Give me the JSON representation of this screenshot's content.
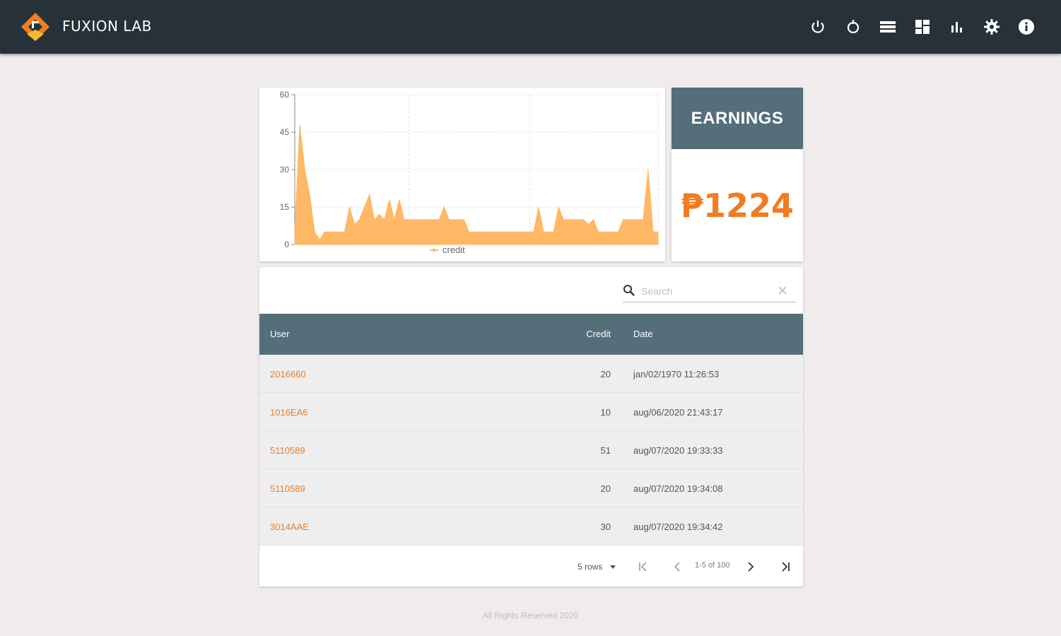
{
  "app": {
    "brand": "FUXION LAB",
    "nav_icons": [
      "power-icon",
      "timer-icon",
      "list-icon",
      "dashboard-icon",
      "bar-chart-icon",
      "settings-icon",
      "info-icon"
    ]
  },
  "colors": {
    "appbar": "#263238",
    "accent": "#f07c23",
    "header_slate": "#546e7a",
    "chart_fill": "#ffb866"
  },
  "earnings": {
    "title": "EARNINGS",
    "value": "₱1224"
  },
  "chart_data": {
    "type": "area",
    "title": "",
    "xlabel": "",
    "ylabel": "",
    "ylim": [
      0,
      60
    ],
    "yticks": [
      "0",
      "15",
      "30",
      "45",
      "60"
    ],
    "grid": true,
    "legend_position": "bottom",
    "series": [
      {
        "name": "credit",
        "values": [
          5,
          48,
          30,
          20,
          5,
          2,
          5,
          5,
          5,
          5,
          5,
          15,
          8,
          10,
          15,
          20,
          10,
          12,
          10,
          18,
          10,
          18,
          10,
          10,
          10,
          10,
          10,
          10,
          10,
          10,
          15,
          10,
          10,
          10,
          10,
          5,
          5,
          5,
          5,
          5,
          5,
          5,
          5,
          5,
          5,
          5,
          5,
          5,
          5,
          15,
          5,
          5,
          5,
          15,
          10,
          10,
          10,
          10,
          10,
          8,
          10,
          5,
          5,
          5,
          5,
          5,
          10,
          10,
          10,
          10,
          10,
          30,
          5,
          5
        ]
      }
    ]
  },
  "table": {
    "search_placeholder": "Search",
    "columns": {
      "user": "User",
      "credit": "Credit",
      "date": "Date"
    },
    "rows": [
      {
        "user": "2016660",
        "credit": "20",
        "date": "jan/02/1970 11:26:53"
      },
      {
        "user": "1016EA6",
        "credit": "10",
        "date": "aug/06/2020 21:43:17"
      },
      {
        "user": "5110589",
        "credit": "51",
        "date": "aug/07/2020 19:33:33"
      },
      {
        "user": "5110589",
        "credit": "20",
        "date": "aug/07/2020 19:34:08"
      },
      {
        "user": "3014AAE",
        "credit": "30",
        "date": "aug/07/2020 19:34:42"
      }
    ],
    "pagination": {
      "rows_label": "5 rows",
      "range": "1-5 of 100"
    }
  },
  "footer": {
    "text": "All Rights Reserved 2020"
  }
}
